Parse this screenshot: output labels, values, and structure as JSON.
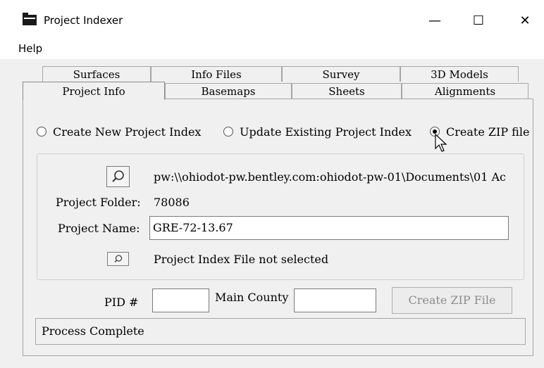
{
  "window": {
    "title": "Project Indexer",
    "minimize": "—",
    "maximize": "☐",
    "close": "✕"
  },
  "menu": {
    "help": "Help"
  },
  "tabs": {
    "row1": [
      "Surfaces",
      "Info Files",
      "Survey",
      "3D Models"
    ],
    "row2": [
      "Project Info",
      "Basemaps",
      "Sheets",
      "Alignments"
    ],
    "selected": "Project Info"
  },
  "options": {
    "create_new": "Create New Project Index",
    "update_existing": "Update Existing Project Index",
    "create_zip": "Create ZIP file",
    "selected": "create_zip"
  },
  "project": {
    "path": "pw:\\\\ohiodot-pw.bentley.com:ohiodot-pw-01\\Documents\\01 Ac",
    "folder_label": "Project Folder:",
    "folder_value": "78086",
    "name_label": "Project Name:",
    "name_value": "GRE-72-13.67",
    "index_file_status": "Project Index File not selected"
  },
  "bottom": {
    "pid_label": "PID #",
    "pid_value": "",
    "county_label": "Main County",
    "county_value": "",
    "zip_button": "Create ZIP File"
  },
  "status": {
    "text": "Process Complete"
  },
  "icons": {
    "app": "folder-icon",
    "browse": "magnifier-icon"
  }
}
